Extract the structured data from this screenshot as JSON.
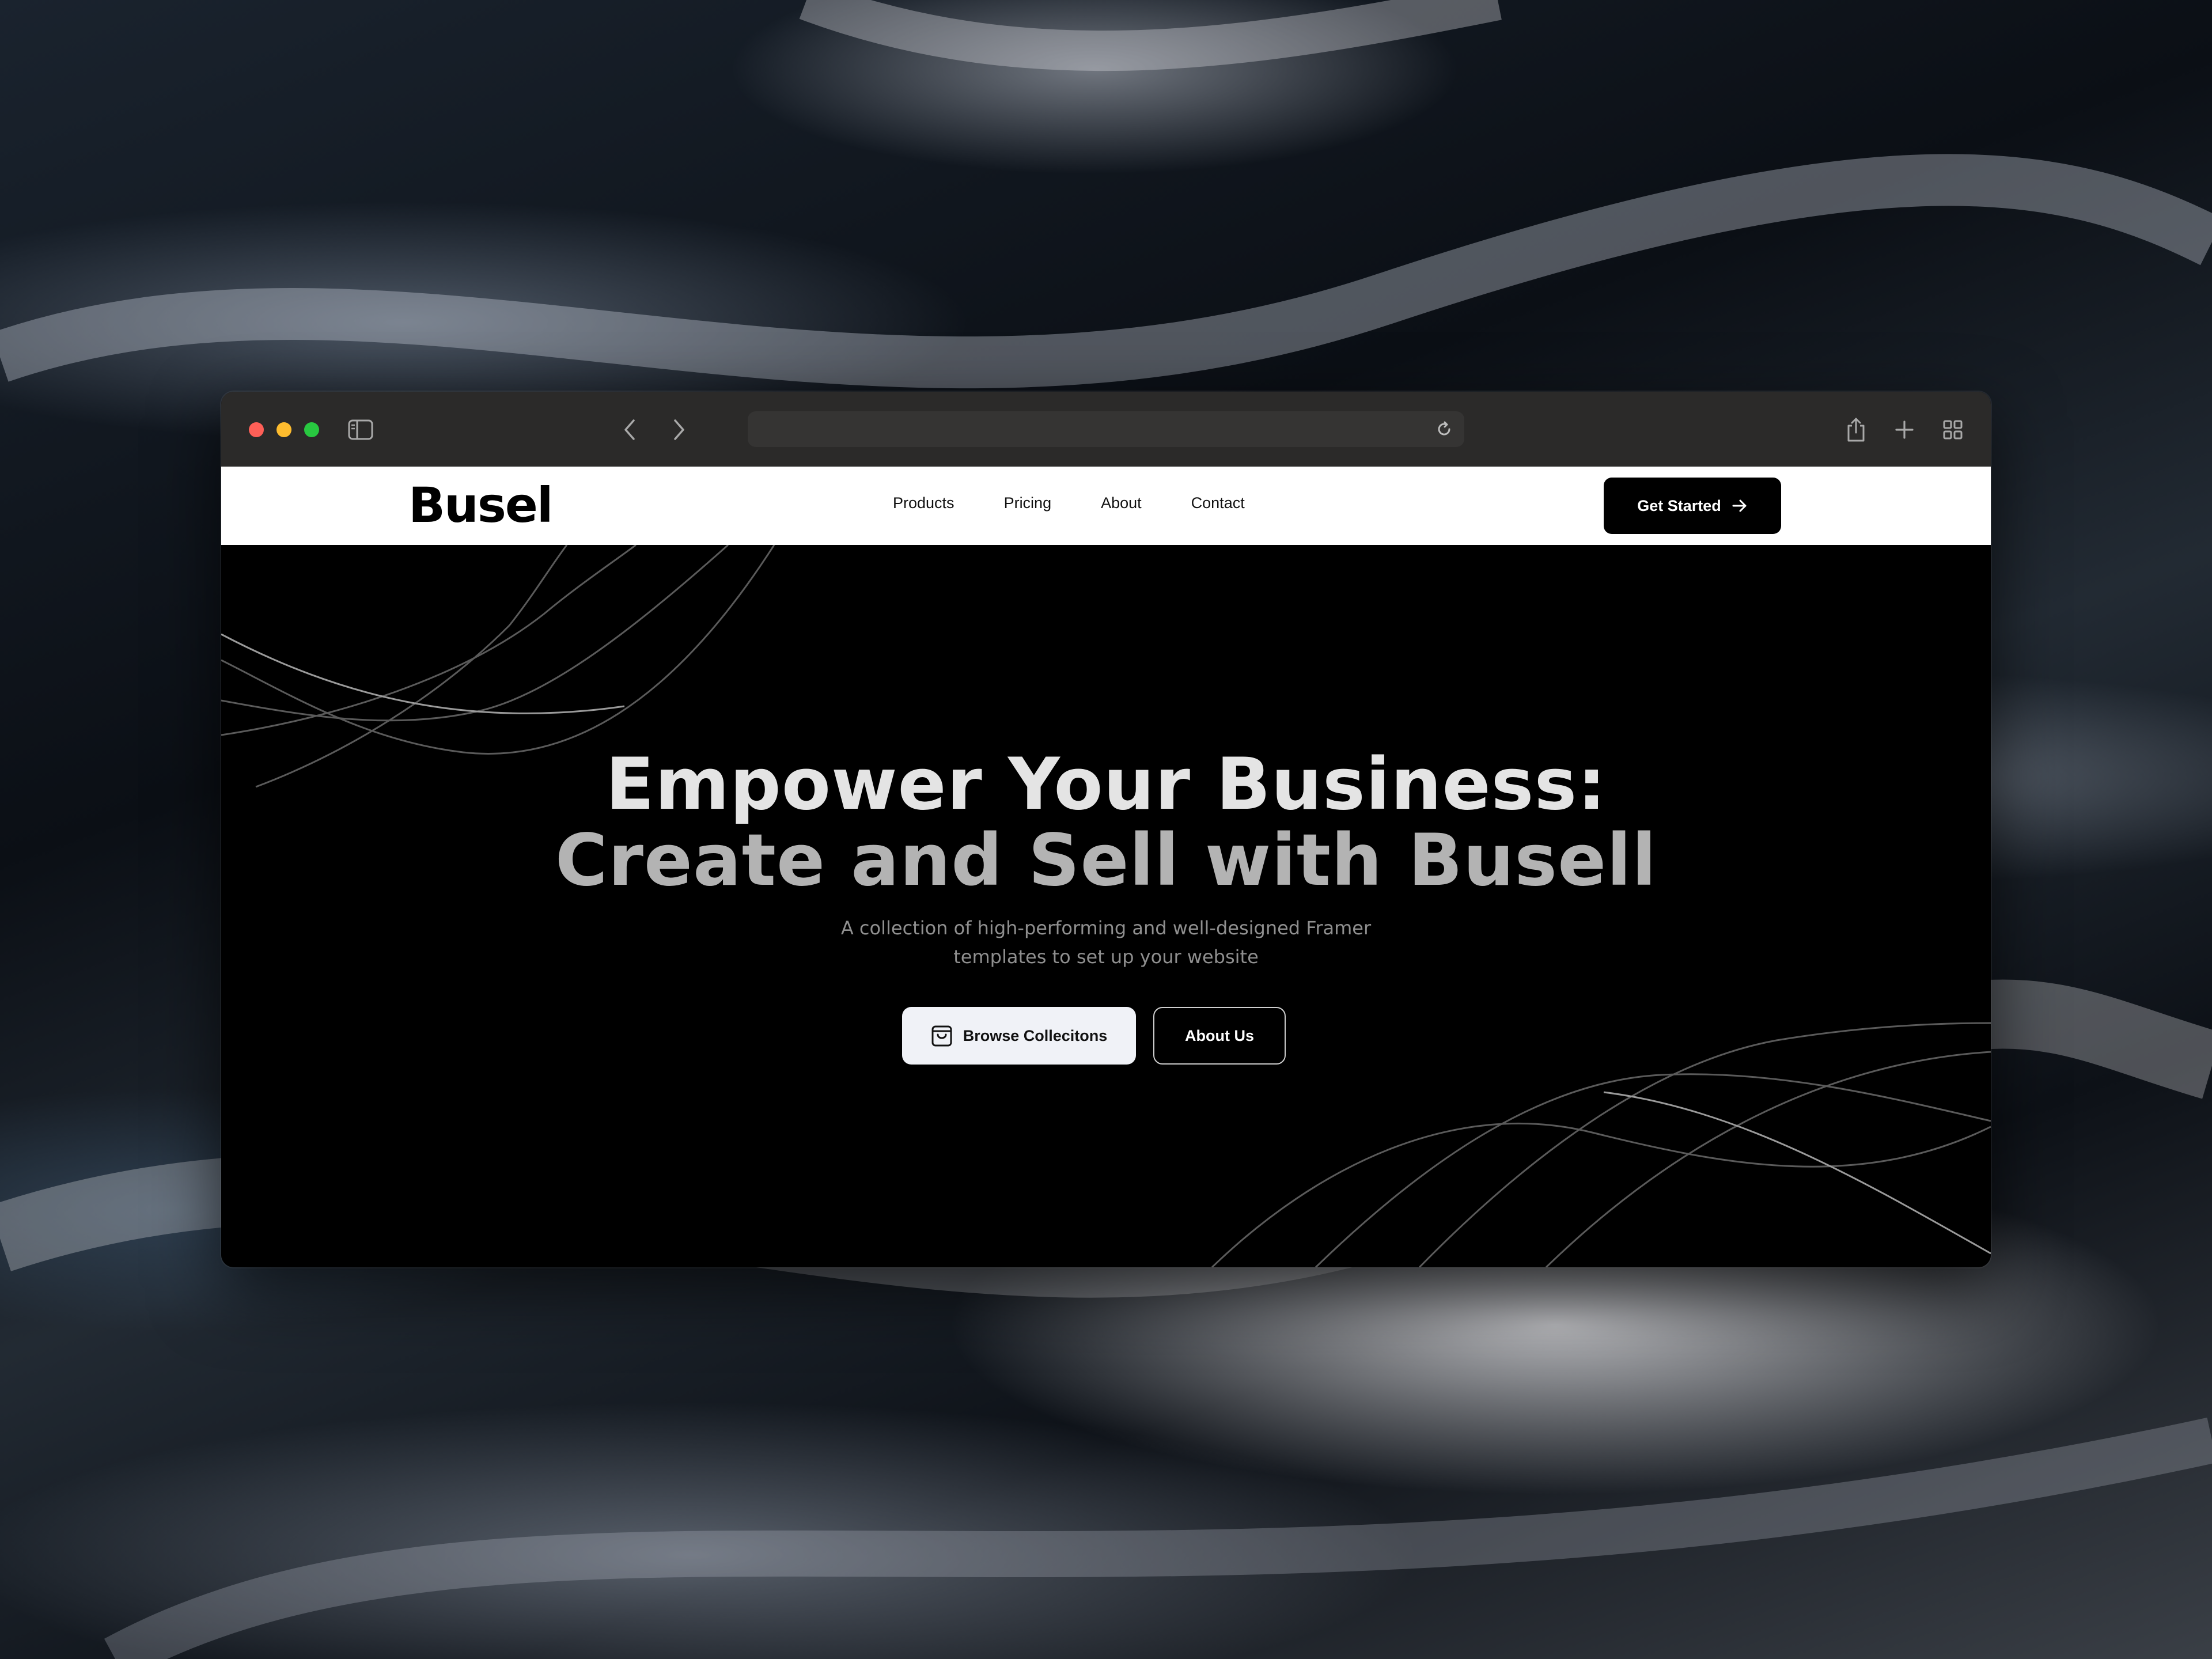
{
  "browser": {
    "address_bar_text": "",
    "icons": [
      "sidebar-icon",
      "back-icon",
      "forward-icon",
      "reload-icon",
      "share-icon",
      "new-tab-icon",
      "tab-overview-icon"
    ],
    "traffic_lights": {
      "close": "#fe5f57",
      "minimize": "#febc2e",
      "zoom": "#28c840"
    }
  },
  "site": {
    "logo": "Busel",
    "nav": [
      "Products",
      "Pricing",
      "About",
      "Contact"
    ],
    "cta_label": "Get Started",
    "cta_icon": "arrow-right-icon"
  },
  "hero": {
    "headline_line1": "Empower Your Business:",
    "headline_line2": "Create and Sell with Busell",
    "subtitle_line1": "A collection of high-performing and well-designed Framer",
    "subtitle_line2": "templates to set up your website",
    "primary_button": {
      "label": "Browse Collecitons",
      "icon": "shopping-bag-icon"
    },
    "secondary_button": {
      "label": "About Us"
    }
  },
  "colors": {
    "accent": "#000000",
    "hero_background": "#000000",
    "primary_button_bg": "#f0f2f7"
  }
}
